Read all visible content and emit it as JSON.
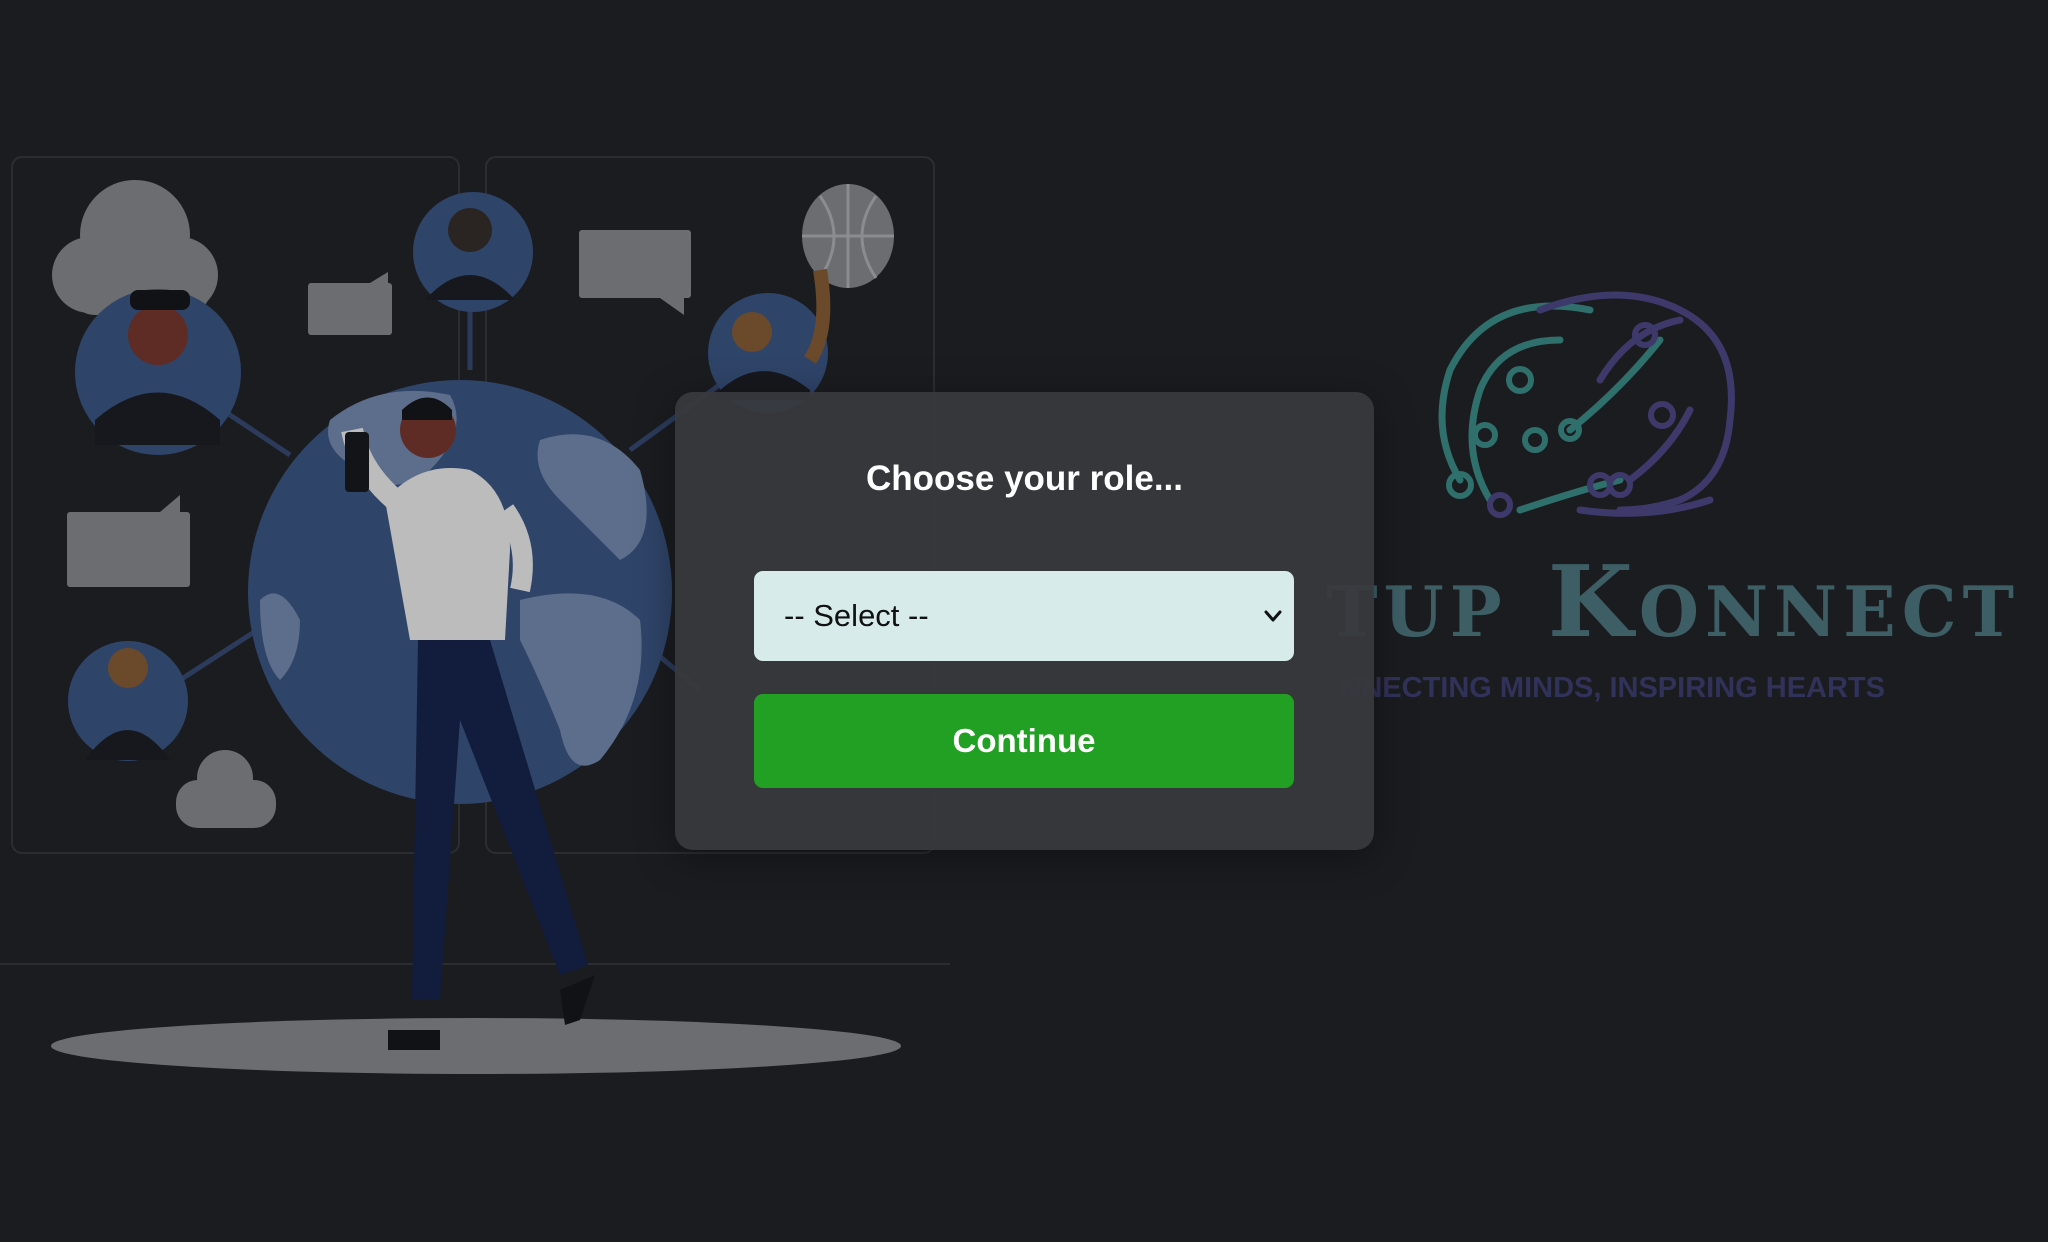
{
  "modal": {
    "title": "Choose your role...",
    "role_select": {
      "selected": "-- Select --"
    },
    "continue_label": "Continue"
  },
  "brand": {
    "name": "Startup Konnect",
    "visible_name": "tup Konnect",
    "tagline": "NNECTING MINDS, INSPIRING HEARTS"
  },
  "colors": {
    "background": "#1b1c20",
    "modal_bg": "#38393d",
    "select_bg": "#d7ebeb",
    "continue_bg": "#22a023",
    "brand_name": "#3e5e66",
    "brand_tagline": "#31325a",
    "logo_teal": "#2f6f6c",
    "logo_purple": "#3d3a6b"
  },
  "icons": [
    "chevron-down-icon",
    "brain-circuit-icon",
    "globe-icon",
    "cloud-icon",
    "chat-bubble-icon",
    "person-avatar-icon"
  ]
}
